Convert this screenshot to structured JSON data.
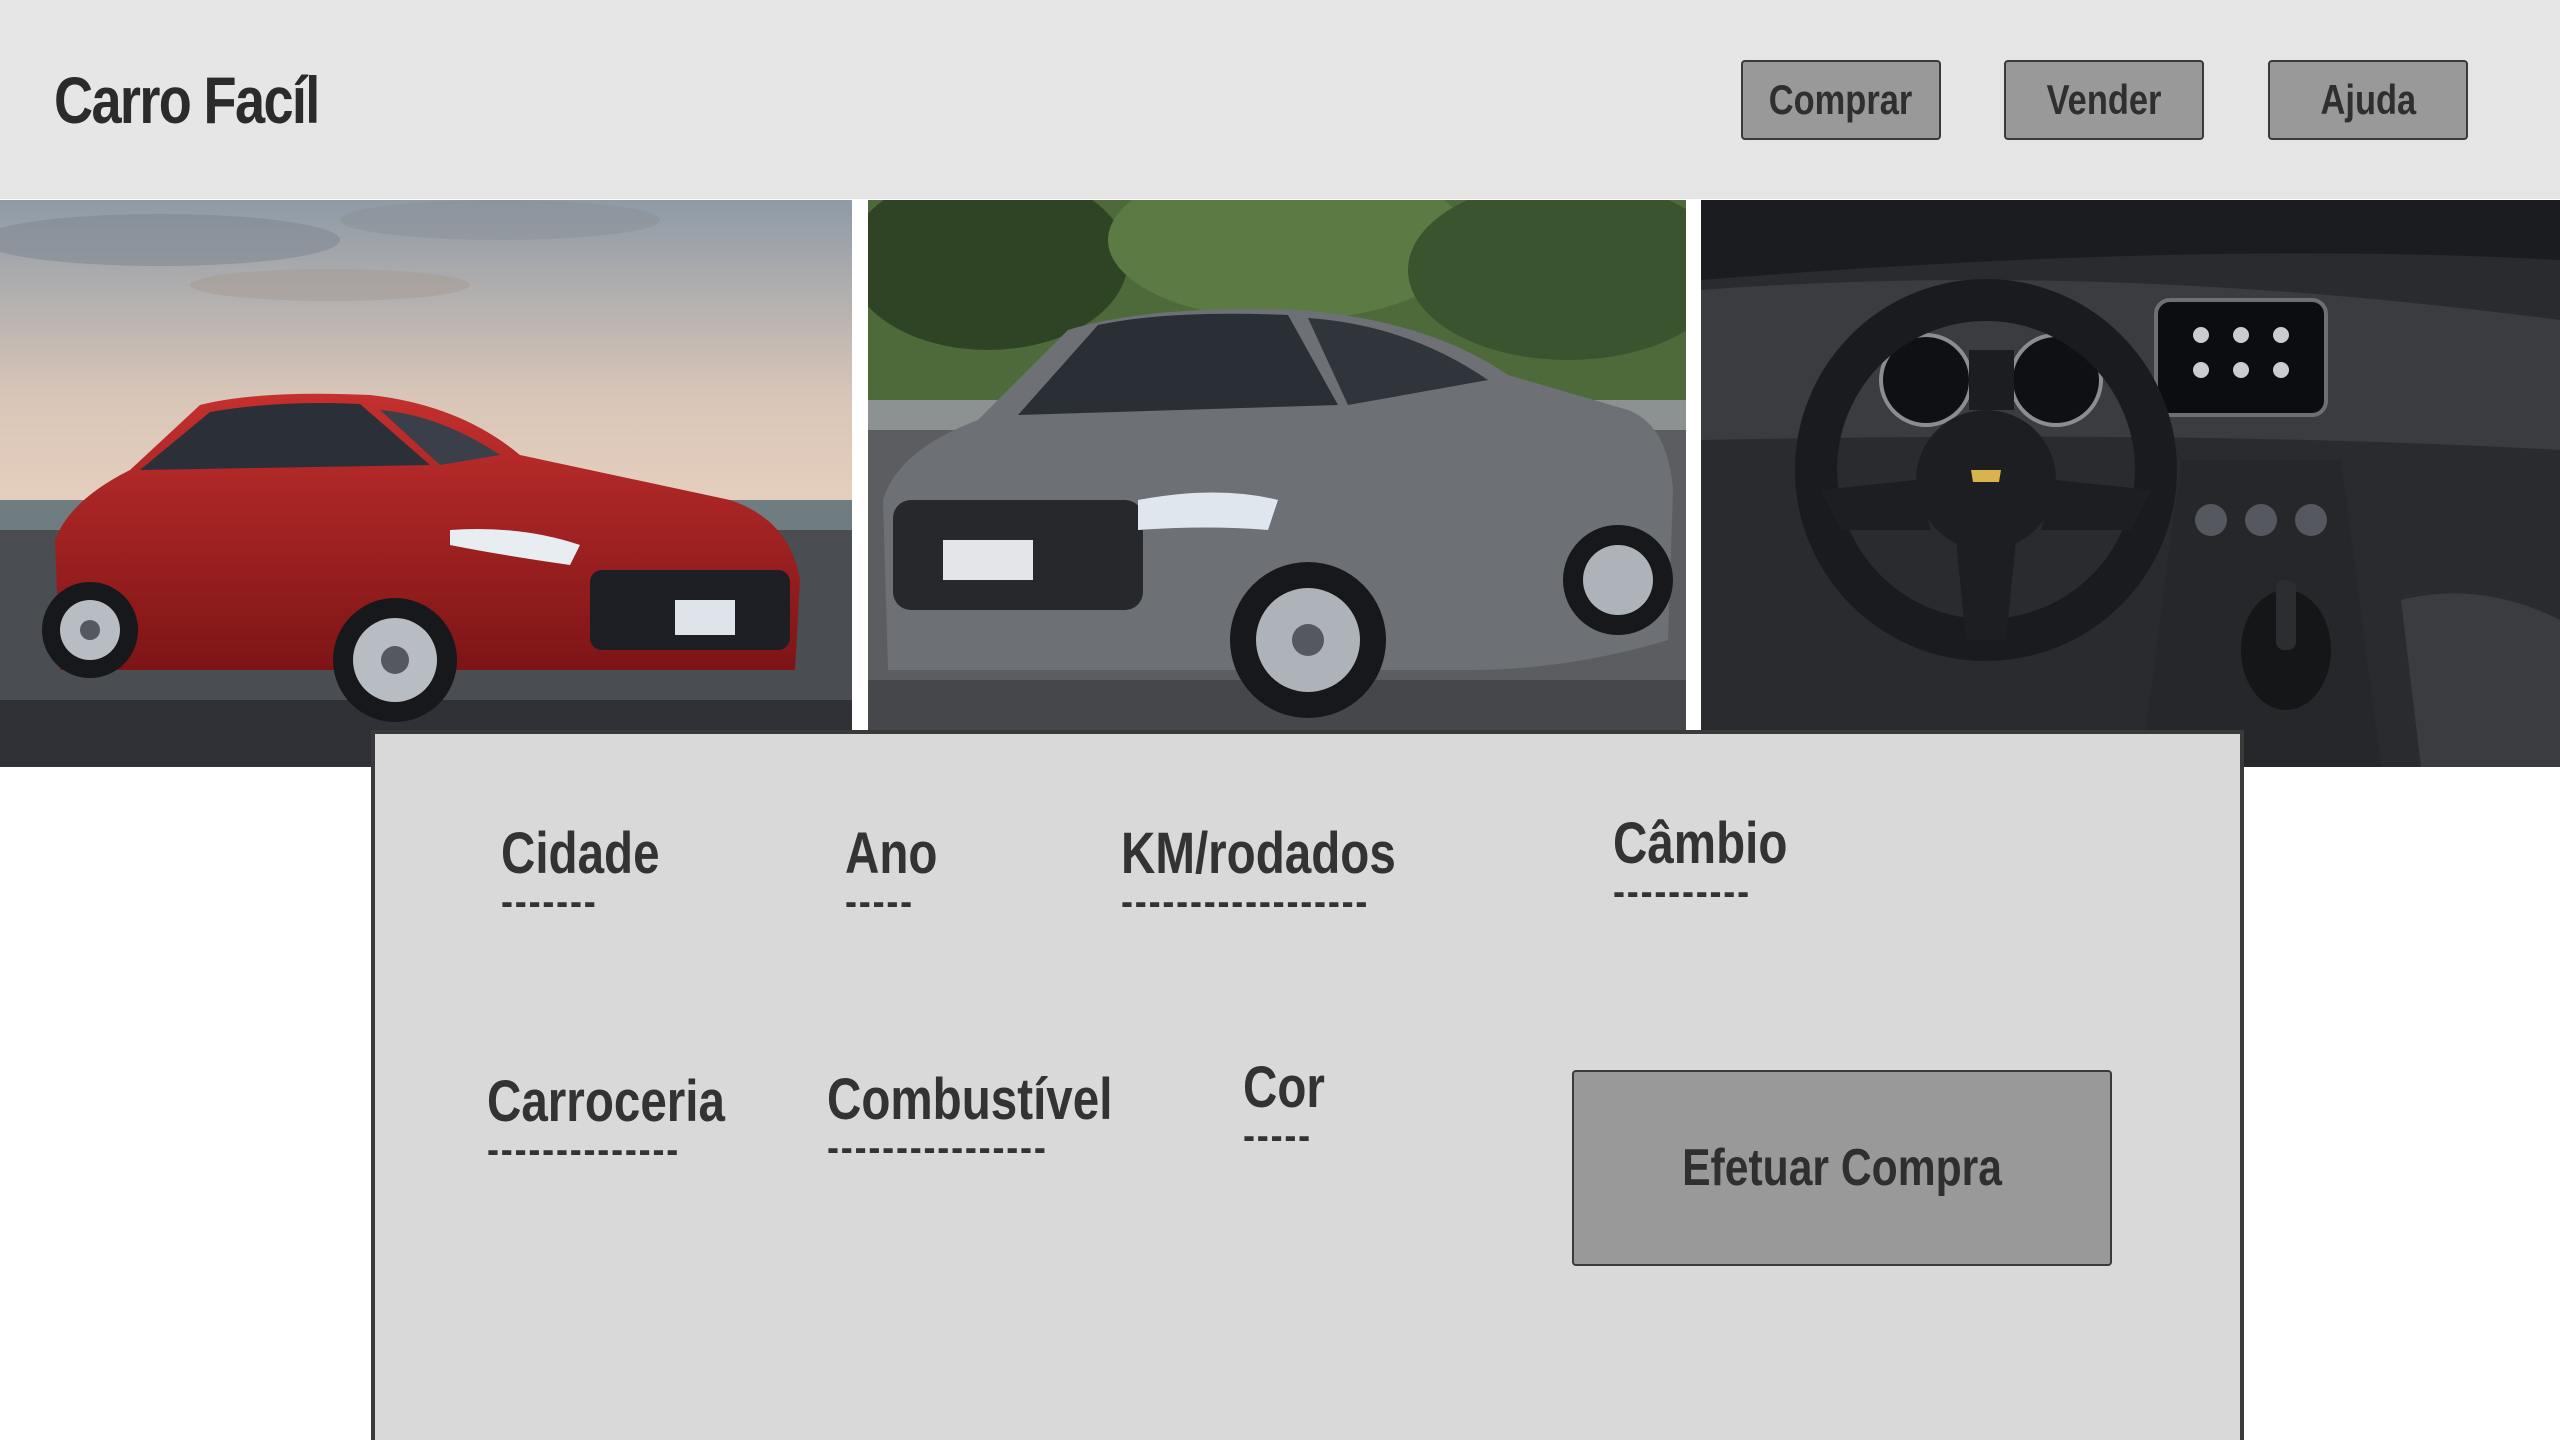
{
  "header": {
    "brand": "Carro Facíl",
    "nav": {
      "buy": "Comprar",
      "sell": "Vender",
      "help": "Ajuda"
    }
  },
  "gallery": {
    "photos": [
      {
        "name": "red-hatchback-photo"
      },
      {
        "name": "gray-sedan-photo"
      },
      {
        "name": "car-interior-photo"
      }
    ]
  },
  "details": {
    "city": {
      "label": "Cidade",
      "value": "-------"
    },
    "year": {
      "label": "Ano",
      "value": "-----"
    },
    "km": {
      "label": "KM/rodados",
      "value": "------------------"
    },
    "transmission": {
      "label": "Câmbio",
      "value": "----------"
    },
    "body": {
      "label": "Carroceria",
      "value": "--------------"
    },
    "fuel": {
      "label": "Combustível",
      "value": "----------------"
    },
    "color": {
      "label": "Cor",
      "value": "-----"
    }
  },
  "actions": {
    "purchase": "Efetuar Compra"
  }
}
